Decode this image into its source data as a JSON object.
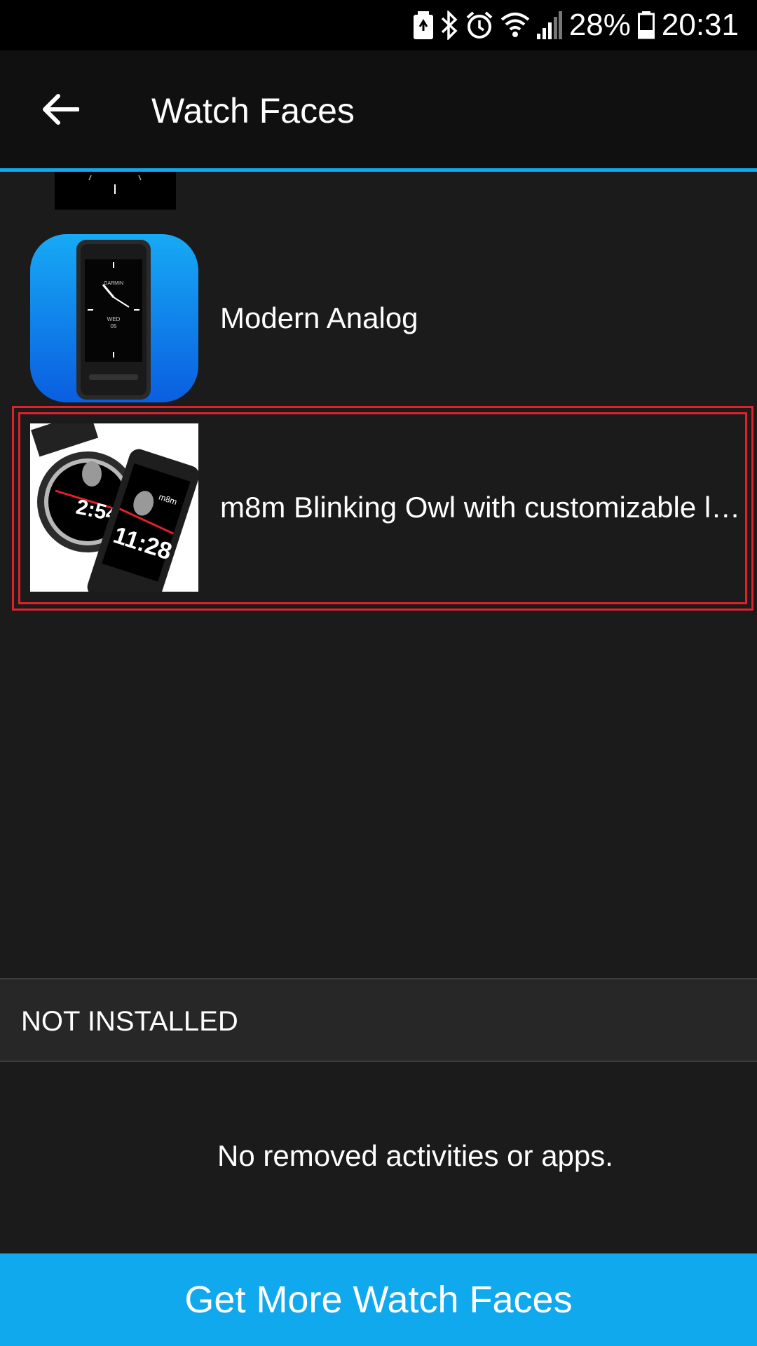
{
  "status_bar": {
    "battery_percent": "28%",
    "time": "20:31",
    "icons": [
      "battery-saver-icon",
      "bluetooth-icon",
      "alarm-icon",
      "wifi-icon",
      "signal-icon",
      "battery-icon"
    ]
  },
  "app_bar": {
    "back_icon": "arrow-left-icon",
    "title": "Watch Faces"
  },
  "installed": [
    {
      "name": "Modern Analog",
      "thumb": "modern-analog-thumbnail",
      "watch_brand": "GARMIN",
      "watch_day": "WED",
      "watch_date": "05"
    },
    {
      "name": "m8m Blinking Owl with customizable lo...",
      "thumb": "blinking-owl-thumbnail",
      "round_time": "2:54",
      "rect_time": "11:28",
      "brand_mark": "m8m",
      "highlighted": true
    }
  ],
  "not_installed": {
    "header": "NOT INSTALLED",
    "empty_message": "No removed activities or apps."
  },
  "cta": {
    "label": "Get More Watch Faces"
  },
  "colors": {
    "background": "#1b1b1b",
    "accent": "#11a9ed",
    "highlight": "#e0202a"
  }
}
